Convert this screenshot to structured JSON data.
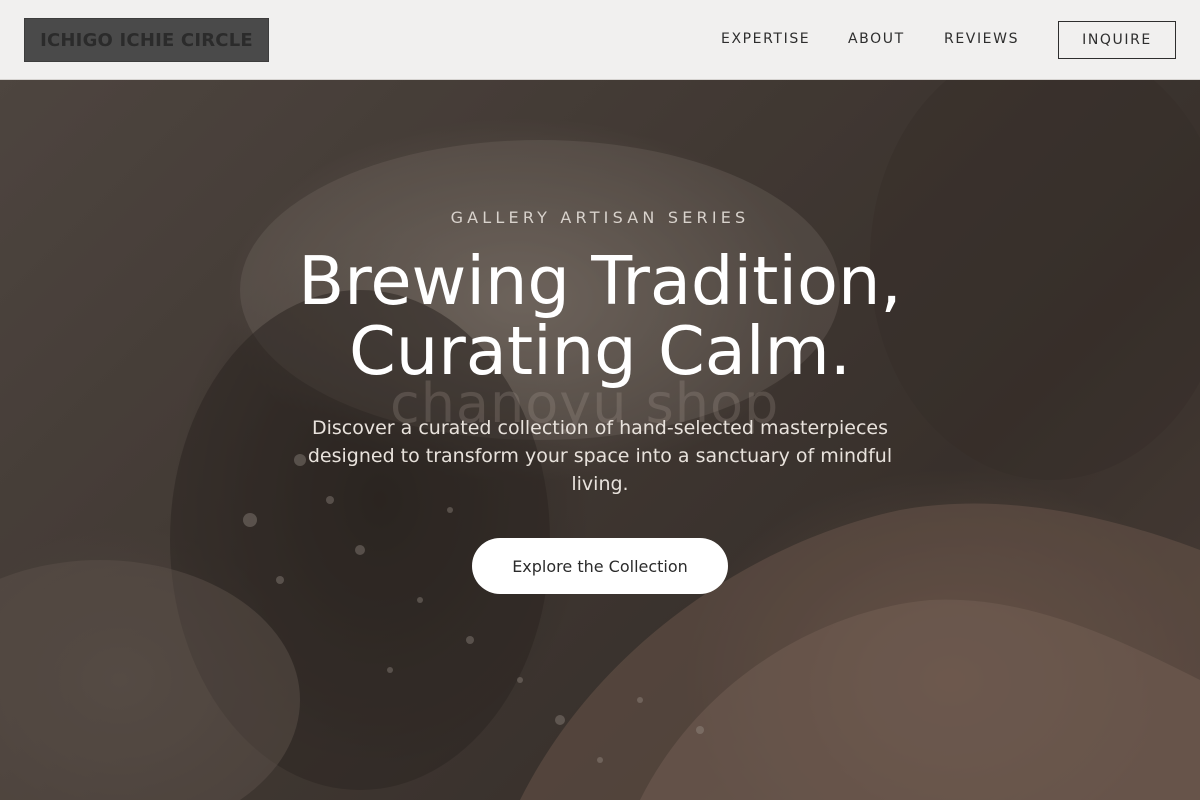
{
  "header": {
    "logo_text": "ICHIGO ICHIE CIRCLE",
    "nav": {
      "expertise": "EXPERTISE",
      "about": "ABOUT",
      "reviews": "REVIEWS"
    },
    "inquire_label": "INQUIRE"
  },
  "hero": {
    "eyebrow": "GALLERY ARTISAN SERIES",
    "headline_line1": "Brewing Tradition,",
    "headline_line2": "Curating Calm.",
    "background_watermark": "chanoyu shop",
    "subtext": "Discover a curated collection of hand-selected masterpieces designed to transform your space into a sanctuary of mindful living.",
    "cta_label": "Explore the Collection"
  },
  "colors": {
    "header_bg": "#f1f0ef",
    "logo_bg": "#4a4a4a",
    "text_dark": "#2e2e2e",
    "hero_text": "#ffffff",
    "cta_bg": "#ffffff"
  }
}
